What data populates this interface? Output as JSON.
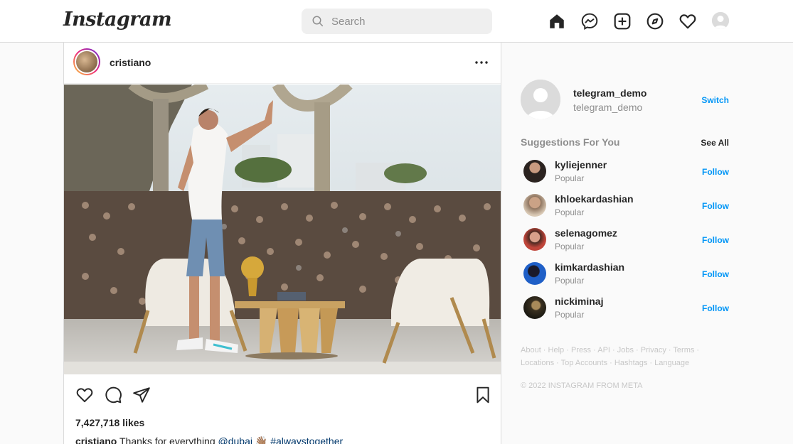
{
  "header": {
    "logo_text": "Instagram",
    "search_placeholder": "Search"
  },
  "nav_icons": [
    "home-icon",
    "messenger-icon",
    "new-post-icon",
    "explore-icon",
    "activity-heart-icon",
    "profile-avatar"
  ],
  "post": {
    "username": "cristiano",
    "likes": "7,427,718 likes",
    "caption_user": "cristiano",
    "caption_text": "Thanks for everything",
    "caption_mention": "@dubai",
    "caption_emoji": "👋🏽",
    "caption_hashtag": "#alwaystogether"
  },
  "sidebar": {
    "current_user_name": "telegram_demo",
    "current_user_sub": "telegram_demo",
    "switch_label": "Switch",
    "suggestions_title": "Suggestions For You",
    "see_all_label": "See All",
    "suggestions": [
      {
        "name": "kyliejenner",
        "sub": "Popular",
        "action": "Follow",
        "avatar_color": "#2b2320"
      },
      {
        "name": "khloekardashian",
        "sub": "Popular",
        "action": "Follow",
        "avatar_color": "#b89a80"
      },
      {
        "name": "selenagomez",
        "sub": "Popular",
        "action": "Follow",
        "avatar_color": "#c0453a"
      },
      {
        "name": "kimkardashian",
        "sub": "Popular",
        "action": "Follow",
        "avatar_color": "#1f5fc7"
      },
      {
        "name": "nickiminaj",
        "sub": "Popular",
        "action": "Follow",
        "avatar_color": "#3a3020"
      }
    ],
    "footer_links": [
      "About",
      "Help",
      "Press",
      "API",
      "Jobs",
      "Privacy",
      "Terms",
      "Locations",
      "Top Accounts",
      "Hashtags",
      "Language"
    ],
    "copyright": "© 2022 INSTAGRAM FROM META"
  },
  "colors": {
    "accent": "#0095f6",
    "text": "#262626",
    "muted": "#8e8e8e",
    "border": "#dbdbdb"
  }
}
